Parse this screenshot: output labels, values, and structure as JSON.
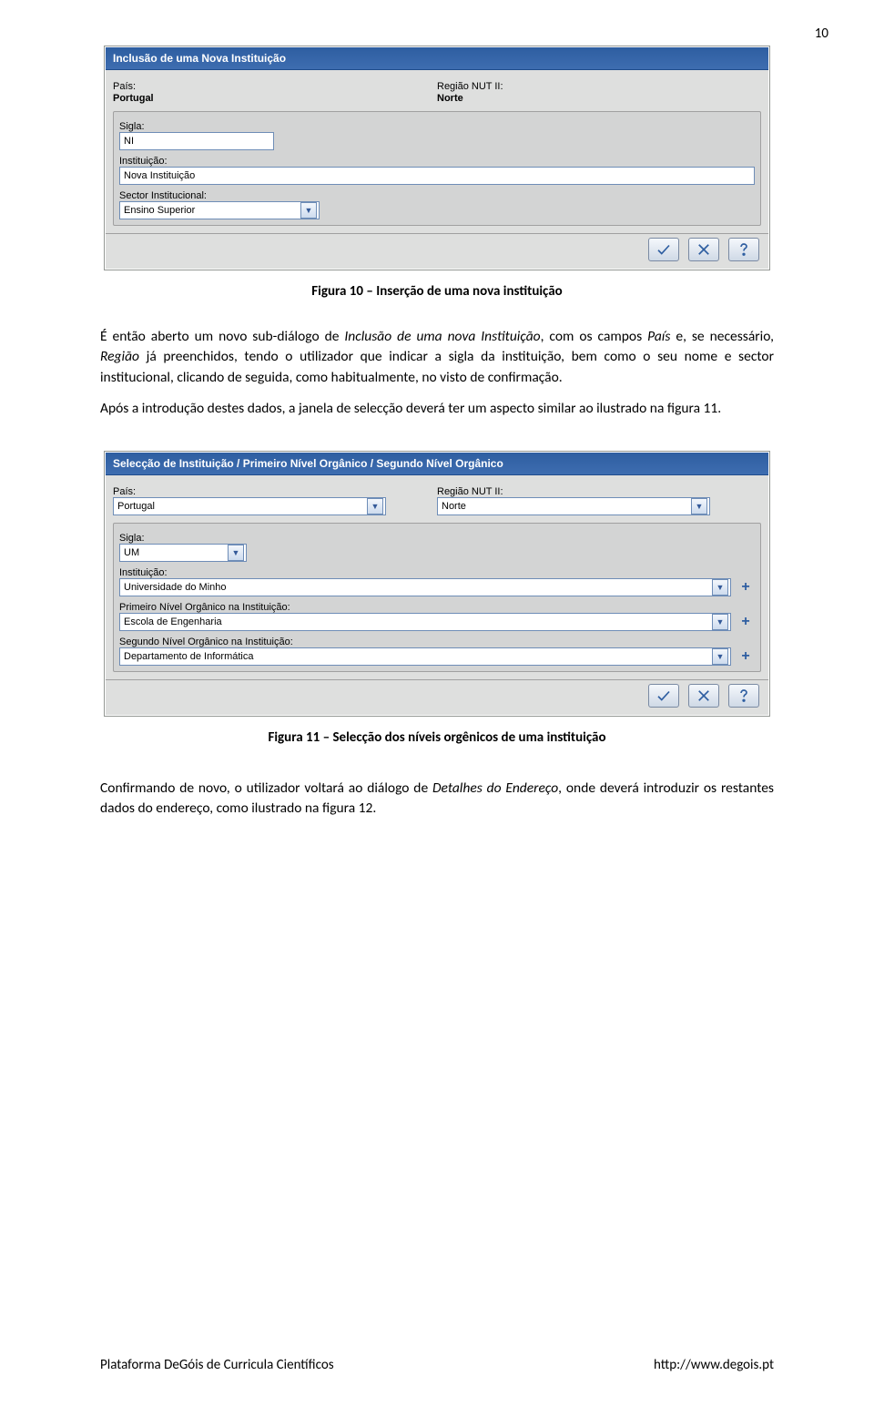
{
  "page_number": "10",
  "caption1": "Figura 10 – Inserção de uma nova instituição",
  "para1_a": "É então aberto um novo sub-diálogo de ",
  "para1_i1": "Inclusão de uma nova Instituição",
  "para1_b": ", com os campos ",
  "para1_i2": "País",
  "para1_c": " e, se necessário, ",
  "para1_i3": "Região",
  "para1_d": " já preenchidos, tendo o utilizador que indicar a sigla da instituição, bem como o seu nome e sector institucional, clicando de seguida, como habitualmente, no visto de confirmação.",
  "para2": "Após a introdução destes dados, a janela de selecção deverá ter um aspecto similar ao ilustrado na figura 11.",
  "caption2": "Figura 11 – Selecção dos níveis orgênicos de uma instituição",
  "para3_a": "Confirmando de novo, o utilizador voltará ao diálogo de ",
  "para3_i1": "Detalhes do Endereço",
  "para3_b": ", onde deverá introduzir os restantes dados do endereço, como ilustrado na figura 12.",
  "footer_left": "Plataforma DeGóis de Curricula Científicos",
  "footer_right": "http://www.degois.pt",
  "dialog1": {
    "title": "Inclusão de uma Nova Instituição",
    "pais_label": "País:",
    "pais_value": "Portugal",
    "regiao_label": "Região NUT II:",
    "regiao_value": "Norte",
    "sigla_label": "Sigla:",
    "sigla_value": "NI",
    "inst_label": "Instituição:",
    "inst_value": "Nova Instituição",
    "sector_label": "Sector Institucional:",
    "sector_value": "Ensino Superior"
  },
  "dialog2": {
    "title": "Selecção de Instituição / Primeiro Nível Orgânico / Segundo Nível Orgânico",
    "pais_label": "País:",
    "pais_value": "Portugal",
    "regiao_label": "Região NUT II:",
    "regiao_value": "Norte",
    "sigla_label": "Sigla:",
    "sigla_value": "UM",
    "inst_label": "Instituição:",
    "inst_value": "Universidade do Minho",
    "niv1_label": "Primeiro Nível Orgânico na Instituição:",
    "niv1_value": "Escola de Engenharia",
    "niv2_label": "Segundo Nível Orgânico na Instituição:",
    "niv2_value": "Departamento de Informática"
  }
}
